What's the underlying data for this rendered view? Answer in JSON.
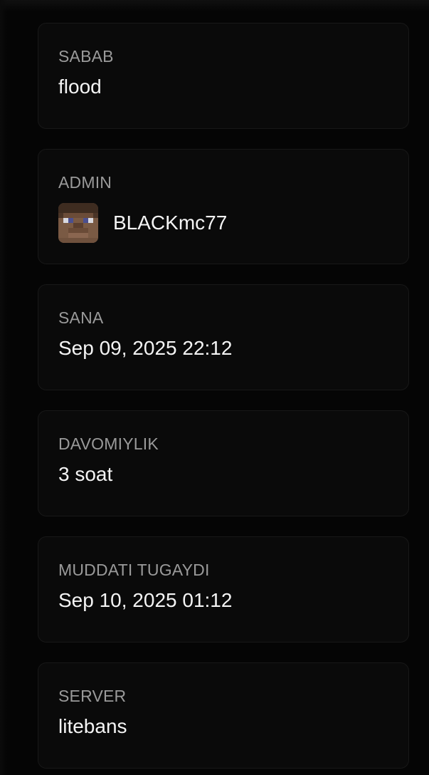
{
  "details": {
    "reason": {
      "label": "SABAB",
      "value": "flood"
    },
    "admin": {
      "label": "ADMIN",
      "name": "BLACKmc77",
      "avatar_icon": "minecraft-player-head-icon"
    },
    "date": {
      "label": "SANA",
      "value": "Sep 09, 2025 22:12"
    },
    "duration": {
      "label": "DAVOMIYLIK",
      "value": "3 soat"
    },
    "expires": {
      "label": "MUDDATI TUGAYDI",
      "value": "Sep 10, 2025 01:12"
    },
    "server": {
      "label": "SERVER",
      "value": "litebans"
    }
  },
  "colors": {
    "background": "#050505",
    "card": "#0a0a0a",
    "card_border": "#181818",
    "label": "#9a9a9a",
    "value": "#f4f4f4"
  }
}
